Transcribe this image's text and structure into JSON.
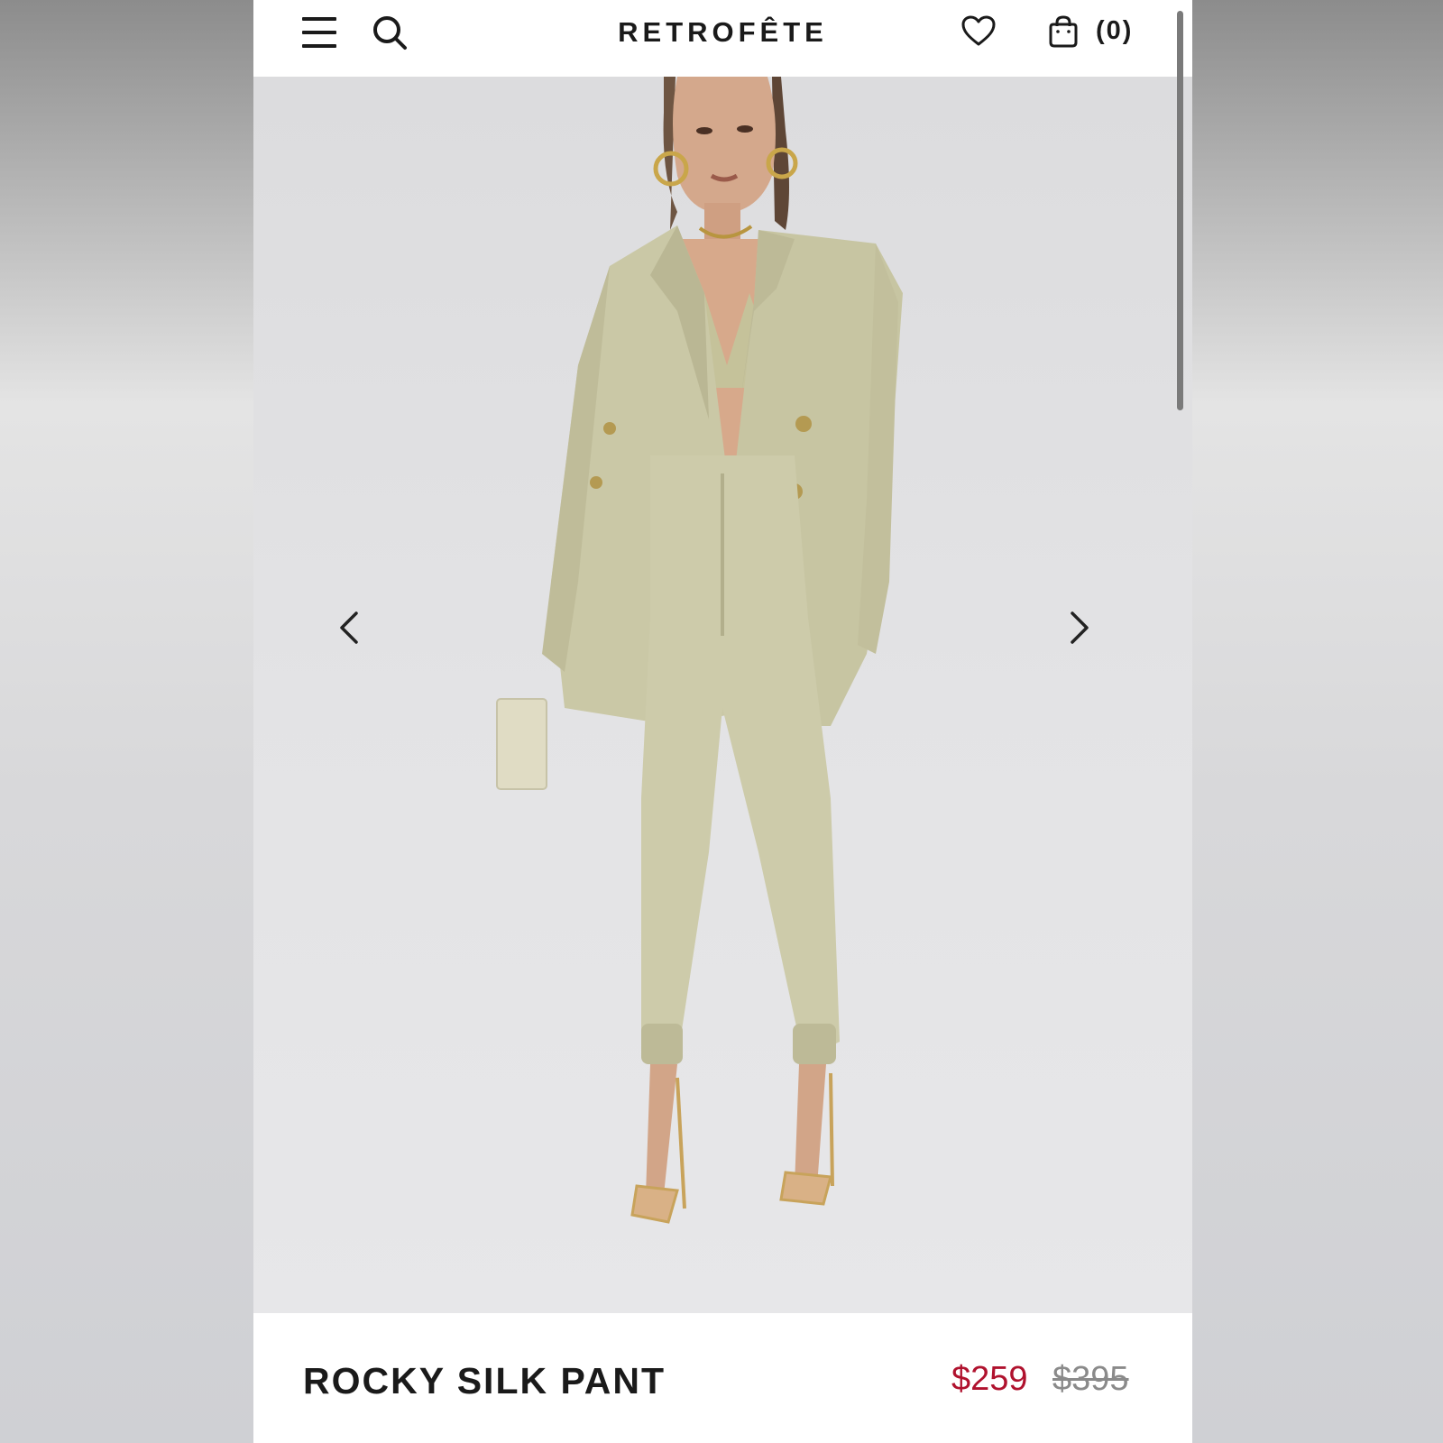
{
  "header": {
    "brand": "RETROFÊTE",
    "cart_count": "(0)",
    "icons": [
      "menu-icon",
      "search-icon",
      "heart-icon",
      "shopping-bag-icon"
    ]
  },
  "gallery": {
    "image_subject": "model wearing sage satin blazer, bralette and jogger pants",
    "prev_icon": "chevron-left-icon",
    "next_icon": "chevron-right-icon"
  },
  "product": {
    "name": "ROCKY SILK PANT",
    "sale_price": "$259",
    "original_price": "$395"
  },
  "colors": {
    "sale": "#b0122e",
    "original": "#8a8a8a",
    "fabric": "#c9c7a4"
  }
}
